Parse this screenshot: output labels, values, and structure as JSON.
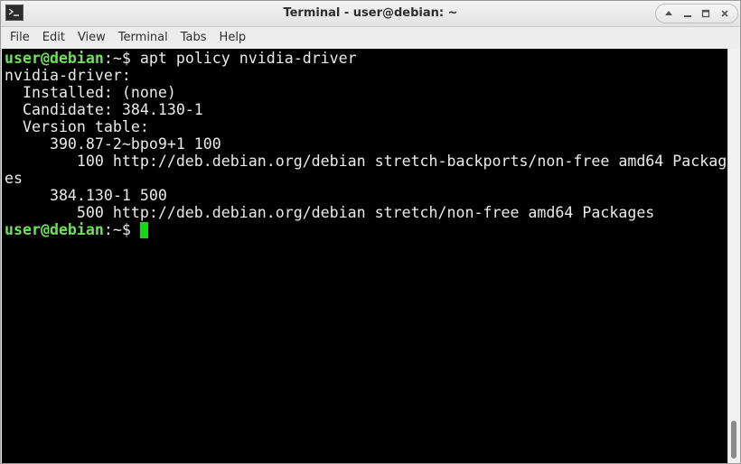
{
  "window": {
    "title": "Terminal - user@debian: ~",
    "controls": [
      "up-arrow-icon",
      "minimize-icon",
      "maximize-icon",
      "close-icon"
    ]
  },
  "menu": {
    "items": [
      "File",
      "Edit",
      "View",
      "Terminal",
      "Tabs",
      "Help"
    ]
  },
  "terminal": {
    "colors": {
      "background": "#000000",
      "foreground": "#eaeaea",
      "prompt_user": "#6ee05a",
      "cursor": "#16d616"
    },
    "prompt": {
      "user_host": "user@debian",
      "path_suffix": ":~$ "
    },
    "command": "apt policy nvidia-driver",
    "output": [
      "nvidia-driver:",
      "  Installed: (none)",
      "  Candidate: 384.130-1",
      "  Version table:",
      "     390.87-2~bpo9+1 100",
      "        100 http://deb.debian.org/debian stretch-backports/non-free amd64 Packag",
      "es",
      "     384.130-1 500",
      "        500 http://deb.debian.org/debian stretch/non-free amd64 Packages"
    ]
  }
}
